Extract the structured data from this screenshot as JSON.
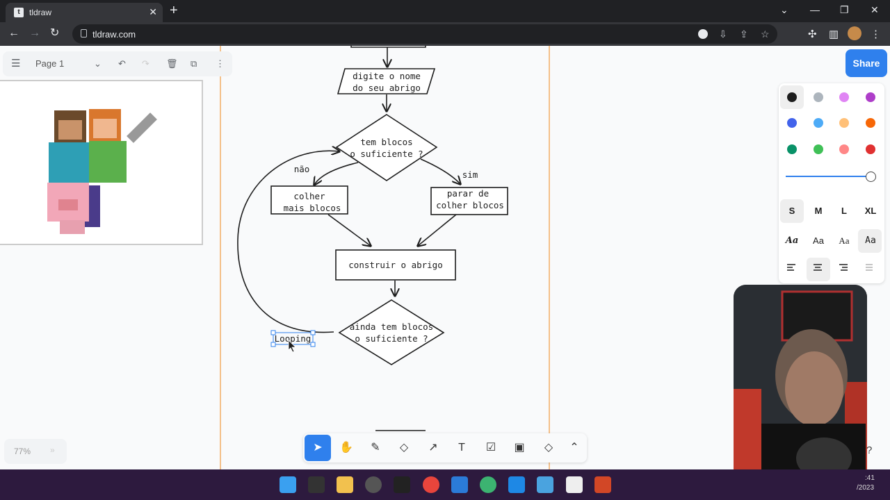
{
  "browser": {
    "tab_title": "tldraw",
    "tab_close": "✕",
    "new_tab": "+",
    "url": "tldraw.com"
  },
  "menu": {
    "page_name": "Page 1"
  },
  "share_label": "Share",
  "style_panel": {
    "colors": [
      "#1d1d1d",
      "#adb5bd",
      "#e085f4",
      "#ae3ec9",
      "#4263eb",
      "#4dabf7",
      "#ffc078",
      "#f76707",
      "#099268",
      "#40c057",
      "#ff8787",
      "#e03131"
    ],
    "sizes": [
      "S",
      "M",
      "L",
      "XL"
    ],
    "selected_size": "S",
    "fonts": [
      "Aa",
      "Aa",
      "Aa",
      "Aa"
    ],
    "accent": "#2f80ed"
  },
  "zoom": {
    "level": "77%",
    "expand": "»"
  },
  "flowchart": {
    "input_box": {
      "line1": "digite o nome",
      "line2": "do seu abrigo"
    },
    "decision1": {
      "line1": "tem blocos",
      "line2": "o suficiente ?"
    },
    "label_no": "não",
    "label_yes": "sim",
    "box_collect": {
      "line1": "colher",
      "line2": "mais blocos"
    },
    "box_stop": {
      "line1": "parar de",
      "line2": "colher blocos"
    },
    "box_build": "construir o abrigo",
    "decision2": {
      "line1": "ainda tem blocos",
      "line2": "o suficiente ?"
    },
    "looping_label": "Looping"
  },
  "webcam_overlay": {
    "clock_time": ":41",
    "clock_year": "/2023",
    "help": "?"
  }
}
